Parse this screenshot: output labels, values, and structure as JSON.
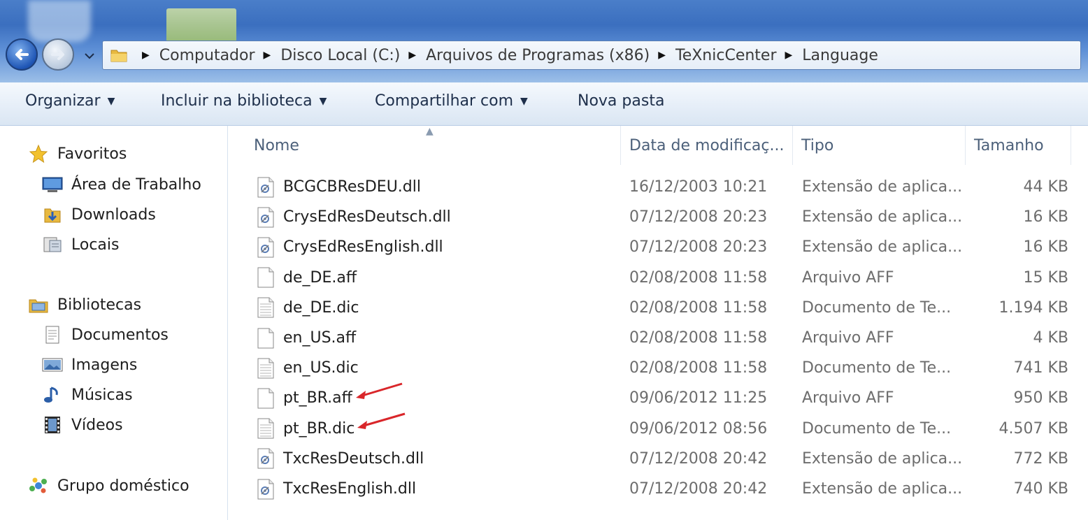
{
  "address_bar": {
    "crumbs": [
      "Computador",
      "Disco Local (C:)",
      "Arquivos de Programas (x86)",
      "TeXnicCenter",
      "Language"
    ]
  },
  "toolbar": {
    "organize_label": "Organizar",
    "include_label": "Incluir na biblioteca",
    "share_label": "Compartilhar com",
    "new_folder_label": "Nova pasta"
  },
  "sidebar": {
    "favorites_label": "Favoritos",
    "favorites_items": [
      {
        "label": "Área de Trabalho",
        "icon": "desktop-icon"
      },
      {
        "label": "Downloads",
        "icon": "downloads-folder-icon"
      },
      {
        "label": "Locais",
        "icon": "recent-places-icon"
      }
    ],
    "libraries_label": "Bibliotecas",
    "libraries_items": [
      {
        "label": "Documentos",
        "icon": "documents-icon"
      },
      {
        "label": "Imagens",
        "icon": "pictures-icon"
      },
      {
        "label": "Músicas",
        "icon": "music-icon"
      },
      {
        "label": "Vídeos",
        "icon": "videos-icon"
      }
    ],
    "homegroup_label": "Grupo doméstico"
  },
  "columns": {
    "name": "Nome",
    "date": "Data de modificaç...",
    "type": "Tipo",
    "size": "Tamanho"
  },
  "files": [
    {
      "name": "BCGCBResDEU.dll",
      "date": "16/12/2003 10:21",
      "type": "Extensão de aplica...",
      "size": "44 KB",
      "icon": "dll-file-icon"
    },
    {
      "name": "CrysEdResDeutsch.dll",
      "date": "07/12/2008 20:23",
      "type": "Extensão de aplica...",
      "size": "16 KB",
      "icon": "dll-file-icon"
    },
    {
      "name": "CrysEdResEnglish.dll",
      "date": "07/12/2008 20:23",
      "type": "Extensão de aplica...",
      "size": "16 KB",
      "icon": "dll-file-icon"
    },
    {
      "name": "de_DE.aff",
      "date": "02/08/2008 11:58",
      "type": "Arquivo AFF",
      "size": "15 KB",
      "icon": "blank-file-icon"
    },
    {
      "name": "de_DE.dic",
      "date": "02/08/2008 11:58",
      "type": "Documento de Te...",
      "size": "1.194 KB",
      "icon": "text-file-icon"
    },
    {
      "name": "en_US.aff",
      "date": "02/08/2008 11:58",
      "type": "Arquivo AFF",
      "size": "4 KB",
      "icon": "blank-file-icon"
    },
    {
      "name": "en_US.dic",
      "date": "02/08/2008 11:58",
      "type": "Documento de Te...",
      "size": "741 KB",
      "icon": "text-file-icon"
    },
    {
      "name": "pt_BR.aff",
      "date": "09/06/2012 11:25",
      "type": "Arquivo AFF",
      "size": "950 KB",
      "icon": "blank-file-icon",
      "highlighted": true
    },
    {
      "name": "pt_BR.dic",
      "date": "09/06/2012 08:56",
      "type": "Documento de Te...",
      "size": "4.507 KB",
      "icon": "text-file-icon",
      "highlighted": true
    },
    {
      "name": "TxcResDeutsch.dll",
      "date": "07/12/2008 20:42",
      "type": "Extensão de aplica...",
      "size": "772 KB",
      "icon": "dll-file-icon"
    },
    {
      "name": "TxcResEnglish.dll",
      "date": "07/12/2008 20:42",
      "type": "Extensão de aplica...",
      "size": "740 KB",
      "icon": "dll-file-icon"
    }
  ],
  "colors": {
    "annotation_arrow": "#d9262a",
    "titlebar_blue": "#3b6fbf"
  }
}
